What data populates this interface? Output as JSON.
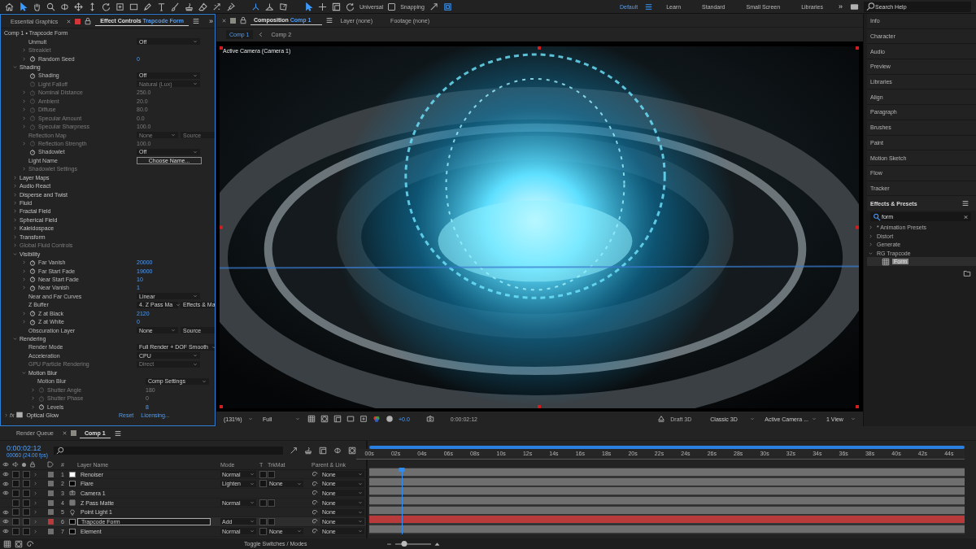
{
  "toolbar": {
    "tools": [
      {
        "kind": "home",
        "selected": false
      },
      {
        "kind": "arrow",
        "selected": true
      },
      {
        "kind": "hand",
        "selected": false
      },
      {
        "kind": "zoom",
        "selected": false
      },
      {
        "kind": "orbit",
        "selected": false
      },
      {
        "kind": "move",
        "selected": false
      },
      {
        "kind": "updown",
        "selected": false
      },
      {
        "kind": "rotate",
        "selected": false
      },
      {
        "kind": "anchor",
        "selected": false
      },
      {
        "kind": "rect",
        "selected": false
      },
      {
        "kind": "pen",
        "selected": false
      },
      {
        "kind": "text",
        "selected": false
      },
      {
        "kind": "brush",
        "selected": false
      },
      {
        "kind": "stamp",
        "selected": false
      },
      {
        "kind": "eraser",
        "selected": false
      },
      {
        "kind": "roto",
        "selected": false
      },
      {
        "kind": "pin",
        "selected": false
      }
    ],
    "axis_modes": [
      {
        "kind": "axis-local",
        "selected": true
      },
      {
        "kind": "axis-world",
        "selected": false
      },
      {
        "kind": "axis-view",
        "selected": false
      }
    ],
    "gizmos": [
      {
        "kind": "arrow",
        "selected": true
      },
      {
        "kind": "plus",
        "selected": false
      },
      {
        "kind": "box",
        "selected": false
      },
      {
        "kind": "rotate",
        "selected": false
      }
    ],
    "gizmo_label": "Universal",
    "snapping": {
      "label": "Snapping",
      "checked": false
    },
    "workspaces": [
      {
        "label": "Default",
        "selected": true
      },
      {
        "label": "Learn",
        "selected": false
      },
      {
        "label": "Standard",
        "selected": false
      },
      {
        "label": "Small Screen",
        "selected": false
      },
      {
        "label": "Libraries",
        "selected": false
      }
    ],
    "overflow": "»",
    "search": {
      "placeholder": "Search Help"
    }
  },
  "effect_controls": {
    "tabs": [
      {
        "label": "Essential Graphics",
        "selected": false
      },
      {
        "label": "Effect Controls",
        "target": "Trapcode Form",
        "selected": true
      }
    ],
    "overflow": "»",
    "header": "Comp 1 • Trapcode Form",
    "continued_rows": [
      {
        "label": "Unmult",
        "kind": "static",
        "disabled": false,
        "control": {
          "kind": "dropdown",
          "value": "Off"
        }
      },
      {
        "label": "Streaklet",
        "kind": "static",
        "expanded": false,
        "disabled": true
      },
      {
        "label": "Random Seed",
        "kind": "animatable",
        "expanded": false,
        "disabled": false,
        "control": {
          "kind": "number",
          "value": "0"
        }
      }
    ],
    "groups": [
      {
        "label": "Shading",
        "kind": "group",
        "expanded": true,
        "disabled": false,
        "children": [
          {
            "label": "Shading",
            "kind": "animatable",
            "disabled": false,
            "control": {
              "kind": "dropdown",
              "value": "Off"
            }
          },
          {
            "label": "Light Falloff",
            "kind": "animatable",
            "disabled": true,
            "control": {
              "kind": "dropdown",
              "value": "Natural (Lux)"
            }
          },
          {
            "label": "Nominal Distance",
            "kind": "animatable",
            "expanded": false,
            "disabled": true,
            "control": {
              "kind": "number",
              "value": "250.0"
            }
          },
          {
            "label": "Ambient",
            "kind": "animatable",
            "expanded": false,
            "disabled": true,
            "control": {
              "kind": "number",
              "value": "20.0"
            }
          },
          {
            "label": "Diffuse",
            "kind": "animatable",
            "expanded": false,
            "disabled": true,
            "control": {
              "kind": "number",
              "value": "80.0"
            }
          },
          {
            "label": "Specular Amount",
            "kind": "animatable",
            "expanded": false,
            "disabled": true,
            "control": {
              "kind": "number",
              "value": "0.0"
            }
          },
          {
            "label": "Specular Sharpness",
            "kind": "animatable",
            "expanded": false,
            "disabled": true,
            "control": {
              "kind": "number",
              "value": "100.0"
            }
          },
          {
            "label": "Reflection Map",
            "kind": "static",
            "disabled": true,
            "control": {
              "kind": "dropdown-pair",
              "values": [
                "None",
                "Source"
              ]
            }
          },
          {
            "label": "Reflection Strength",
            "kind": "animatable",
            "expanded": false,
            "disabled": true,
            "control": {
              "kind": "number",
              "value": "100.0"
            }
          },
          {
            "label": "Shadowlet",
            "kind": "animatable",
            "disabled": false,
            "control": {
              "kind": "dropdown",
              "value": "Off"
            }
          },
          {
            "label": "Light Name",
            "kind": "static",
            "disabled": false,
            "control": {
              "kind": "button",
              "value": "Choose Name..."
            }
          },
          {
            "label": "Shadowlet Settings",
            "kind": "static",
            "expanded": false,
            "disabled": true
          }
        ]
      },
      {
        "label": "Layer Maps",
        "kind": "group",
        "expanded": false,
        "disabled": false
      },
      {
        "label": "Audio React",
        "kind": "group",
        "expanded": false,
        "disabled": false
      },
      {
        "label": "Disperse and Twist",
        "kind": "group",
        "expanded": false,
        "disabled": false
      },
      {
        "label": "Fluid",
        "kind": "group",
        "expanded": false,
        "disabled": false
      },
      {
        "label": "Fractal Field",
        "kind": "group",
        "expanded": false,
        "disabled": false
      },
      {
        "label": "Spherical Field",
        "kind": "group",
        "expanded": false,
        "disabled": false
      },
      {
        "label": "Kaleidospace",
        "kind": "group",
        "expanded": false,
        "disabled": false
      },
      {
        "label": "Transform",
        "kind": "group",
        "expanded": false,
        "disabled": false
      },
      {
        "label": "Global Fluid Controls",
        "kind": "group",
        "expanded": false,
        "disabled": true
      },
      {
        "label": "Visibility",
        "kind": "group",
        "expanded": true,
        "disabled": false,
        "children": [
          {
            "label": "Far Vanish",
            "kind": "animatable",
            "expanded": false,
            "disabled": false,
            "control": {
              "kind": "number",
              "value": "20000"
            }
          },
          {
            "label": "Far Start Fade",
            "kind": "animatable",
            "expanded": false,
            "disabled": false,
            "control": {
              "kind": "number",
              "value": "19000"
            }
          },
          {
            "label": "Near Start Fade",
            "kind": "animatable",
            "expanded": false,
            "disabled": false,
            "control": {
              "kind": "number",
              "value": "10"
            }
          },
          {
            "label": "Near Vanish",
            "kind": "animatable",
            "expanded": false,
            "disabled": false,
            "control": {
              "kind": "number",
              "value": "1"
            }
          },
          {
            "label": "Near and Far Curves",
            "kind": "static",
            "disabled": false,
            "control": {
              "kind": "dropdown",
              "value": "Linear"
            }
          },
          {
            "label": "Z Buffer",
            "kind": "static",
            "disabled": false,
            "control": {
              "kind": "dropdown-pair",
              "values": [
                "4. Z Pass Ma",
                "Effects & Ma"
              ]
            }
          },
          {
            "label": "Z at Black",
            "kind": "animatable",
            "expanded": false,
            "disabled": false,
            "control": {
              "kind": "number",
              "value": "2120"
            }
          },
          {
            "label": "Z at White",
            "kind": "animatable",
            "expanded": false,
            "disabled": false,
            "control": {
              "kind": "number",
              "value": "0"
            }
          },
          {
            "label": "Obscuration Layer",
            "kind": "static",
            "disabled": false,
            "control": {
              "kind": "dropdown-pair",
              "values": [
                "None",
                "Source"
              ]
            }
          }
        ]
      },
      {
        "label": "Rendering",
        "kind": "group",
        "expanded": true,
        "disabled": false,
        "children": [
          {
            "label": "Render Mode",
            "kind": "static",
            "disabled": false,
            "control": {
              "kind": "dropdown",
              "value": "Full Render + DOF Smooth"
            }
          },
          {
            "label": "Acceleration",
            "kind": "static",
            "disabled": false,
            "control": {
              "kind": "dropdown",
              "value": "CPU"
            }
          },
          {
            "label": "GPU Particle Rendering",
            "kind": "static",
            "disabled": true,
            "control": {
              "kind": "dropdown",
              "value": "Direct"
            }
          },
          {
            "label": "Motion Blur",
            "kind": "group",
            "expanded": true,
            "disabled": false,
            "children": [
              {
                "label": "Motion Blur",
                "kind": "static",
                "disabled": false,
                "control": {
                  "kind": "dropdown",
                  "value": "Comp Settings"
                }
              },
              {
                "label": "Shutter Angle",
                "kind": "animatable",
                "expanded": false,
                "disabled": true,
                "control": {
                  "kind": "number",
                  "value": "180"
                }
              },
              {
                "label": "Shutter Phase",
                "kind": "animatable",
                "expanded": false,
                "disabled": true,
                "control": {
                  "kind": "number",
                  "value": "0"
                }
              },
              {
                "label": "Levels",
                "kind": "animatable",
                "expanded": false,
                "disabled": false,
                "control": {
                  "kind": "number",
                  "value": "8"
                }
              }
            ]
          }
        ]
      }
    ],
    "next_effect": {
      "fx": "fx",
      "label": "Optical Glow",
      "expanded": false,
      "actions": [
        "Reset",
        "Licensing..."
      ]
    }
  },
  "composition": {
    "tabs": [
      {
        "label": "Composition",
        "target": "Comp 1",
        "selected": true
      },
      {
        "label": "Layer (none)",
        "selected": false
      },
      {
        "label": "Footage (none)",
        "selected": false
      }
    ],
    "breadcrumbs": [
      {
        "label": "Comp 1",
        "selected": true
      },
      {
        "label": "Comp 2",
        "selected": false
      }
    ],
    "viewer_label": "Active Camera (Camera 1)",
    "viewer_bar": {
      "magnification": "(131%)",
      "resolution": "Full",
      "exposure": "+0.0",
      "timecode": "0:00:02:12",
      "renderer": "Draft 3D",
      "renderer_mode": "Classic 3D",
      "camera": "Active Camera ...",
      "views": "1 View"
    }
  },
  "right_panel": {
    "panels": [
      "Info",
      "Character",
      "Audio",
      "Preview",
      "Libraries",
      "Align",
      "Paragraph",
      "Brushes",
      "Paint",
      "Motion Sketch",
      "Flow",
      "Tracker"
    ],
    "effects_presets": {
      "title": "Effects & Presets",
      "search": "form",
      "tree": [
        {
          "label": "* Animation Presets",
          "expanded": false
        },
        {
          "label": "Distort",
          "expanded": false
        },
        {
          "label": "Generate",
          "expanded": false
        },
        {
          "label": "RG Trapcode",
          "expanded": true,
          "children": [
            {
              "label": "Form",
              "selected": true
            }
          ]
        }
      ]
    }
  },
  "timeline": {
    "tabs": [
      {
        "label": "Render Queue",
        "selected": false
      },
      {
        "label": "Comp 1",
        "selected": true
      }
    ],
    "timecode": "0:00:02:12",
    "frame_info": "00060 (24.00 fps)",
    "columns": {
      "number": "#",
      "name": "Layer Name",
      "mode": "Mode",
      "preserve": "T",
      "trkmat": "TrkMat",
      "parent": "Parent & Link"
    },
    "layers": [
      {
        "number": "1",
        "name": "Renoiser",
        "kind": "solid",
        "swatch": {
          "color": "#ffffff"
        },
        "color": "#6f6f6f",
        "visible": true,
        "mode": "Normal",
        "parent": "None",
        "selected": false
      },
      {
        "number": "2",
        "name": "Flare",
        "kind": "solid",
        "swatch": {
          "color": "#000000"
        },
        "color": "#6f6f6f",
        "visible": true,
        "mode": "Lighten",
        "trkmat": "None",
        "parent": "None",
        "selected": false
      },
      {
        "number": "3",
        "name": "Camera 1",
        "kind": "camera",
        "color": "#6f6f6f",
        "visible": true,
        "parent": "None",
        "selected": false
      },
      {
        "number": "4",
        "name": "Z Pass Matte",
        "kind": "footage",
        "color": "#6f6f6f",
        "visible": false,
        "mode": "Normal",
        "parent": "None",
        "selected": false
      },
      {
        "number": "5",
        "name": "Point Light 1",
        "kind": "light",
        "color": "#6f6f6f",
        "visible": true,
        "parent": "None",
        "selected": false
      },
      {
        "number": "6",
        "name": "Trapcode Form",
        "kind": "solid",
        "swatch": {
          "color": "#000000"
        },
        "color": "#b83a3a",
        "visible": true,
        "mode": "Add",
        "parent": "None",
        "selected": true
      },
      {
        "number": "7",
        "name": "Element",
        "kind": "solid",
        "swatch": {
          "color": "#000000"
        },
        "color": "#6f6f6f",
        "visible": true,
        "mode": "Normal",
        "trkmat": "None",
        "parent": "None",
        "selected": false
      }
    ],
    "ruler": [
      "00s",
      "02s",
      "04s",
      "06s",
      "08s",
      "10s",
      "12s",
      "14s",
      "16s",
      "18s",
      "20s",
      "22s",
      "24s",
      "26s",
      "28s",
      "30s",
      "32s",
      "34s",
      "36s",
      "38s",
      "40s",
      "42s",
      "44s"
    ],
    "playhead": {
      "level": 0.055
    },
    "zoom": {
      "level": 0.25
    },
    "footer": "Toggle Switches / Modes"
  }
}
